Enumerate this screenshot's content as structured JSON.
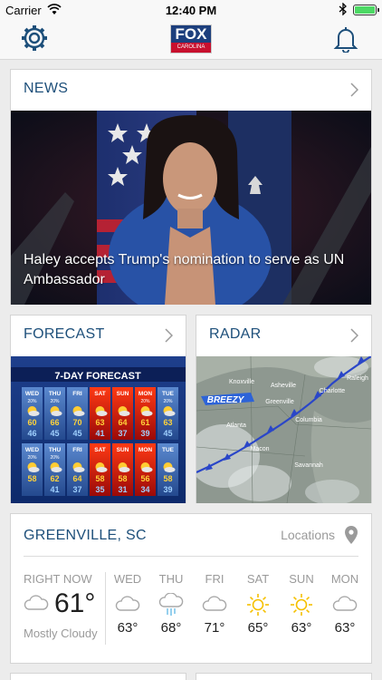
{
  "status_bar": {
    "carrier": "Carrier",
    "time": "12:40 PM"
  },
  "header": {
    "logo_text": "FOX",
    "logo_subtext": "CAROLINA"
  },
  "news": {
    "title": "NEWS",
    "headline": "Haley accepts Trump's nomination to serve as UN Ambassador"
  },
  "forecast": {
    "title": "FORECAST",
    "graphic_title": "7-DAY FORECAST",
    "days": [
      "WED",
      "THU",
      "FRI",
      "SAT",
      "SUN",
      "MON",
      "TUE"
    ],
    "row1": {
      "pct": [
        "20%",
        "20%",
        "",
        "",
        "",
        "20%",
        "20%"
      ],
      "hi": [
        "60",
        "66",
        "70",
        "63",
        "64",
        "61",
        "63"
      ],
      "lo": [
        "46",
        "45",
        "45",
        "41",
        "37",
        "39",
        "45"
      ]
    },
    "row2": {
      "pct": [
        "20%",
        "20%",
        "",
        "",
        "",
        "",
        ""
      ],
      "hi": [
        "58",
        "62",
        "64",
        "58",
        "58",
        "56",
        "58"
      ],
      "lo": [
        "",
        "41",
        "37",
        "35",
        "31",
        "34",
        "39"
      ]
    }
  },
  "radar": {
    "title": "RADAR",
    "badge": "BREEZY",
    "cities": [
      "Knoxville",
      "Asheville",
      "Charlotte",
      "Raleigh",
      "Greenville",
      "Atlanta",
      "Columbia",
      "Macon",
      "Savannah"
    ]
  },
  "weather": {
    "city": "GREENVILLE, SC",
    "locations_label": "Locations",
    "now_label": "RIGHT NOW",
    "now_temp": "61°",
    "now_condition": "Mostly Cloudy",
    "days": [
      {
        "name": "WED",
        "temp": "63°",
        "icon": "cloud-icon"
      },
      {
        "name": "THU",
        "temp": "68°",
        "icon": "rain-cloud-icon"
      },
      {
        "name": "FRI",
        "temp": "71°",
        "icon": "cloud-icon"
      },
      {
        "name": "SAT",
        "temp": "65°",
        "icon": "sun-icon"
      },
      {
        "name": "SUN",
        "temp": "63°",
        "icon": "sun-icon"
      },
      {
        "name": "MON",
        "temp": "63°",
        "icon": "cloud-icon"
      }
    ]
  },
  "colors": {
    "accent": "#1d4f7a",
    "sun": "#f5c000",
    "muted": "#9a9a9a"
  }
}
